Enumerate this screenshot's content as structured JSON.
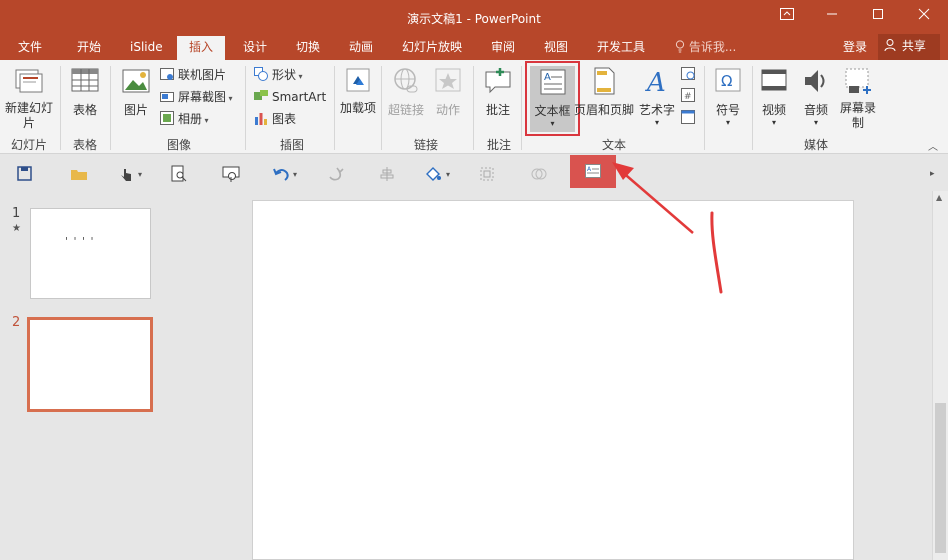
{
  "title": "演示文稿1 - PowerPoint",
  "tabs": [
    "文件",
    "开始",
    "iSlide",
    "插入",
    "设计",
    "切换",
    "动画",
    "幻灯片放映",
    "审阅",
    "视图",
    "开发工具"
  ],
  "tell_me": "告诉我...",
  "signin": "登录",
  "share": "共享",
  "ribbon": {
    "new_slide": "新建幻灯片",
    "slides_group": "幻灯片",
    "table": "表格",
    "tables_group": "表格",
    "picture": "图片",
    "online_picture": "联机图片",
    "screenshot": "屏幕截图",
    "album": "相册",
    "images_group": "图像",
    "shapes": "形状",
    "smartart": "SmartArt",
    "chart": "图表",
    "illustrations_group": "插图",
    "addins": "加载项",
    "hyperlink": "超链接",
    "action": "动作",
    "links_group": "链接",
    "comment": "批注",
    "comments_group": "批注",
    "textbox": "文本框",
    "header_footer": "页眉和页脚",
    "wordart": "艺术字",
    "text_group": "文本",
    "symbols": "符号",
    "video": "视频",
    "audio": "音频",
    "screen_recording": "屏幕录制",
    "media_group": "媒体"
  },
  "slides": [
    {
      "number": "1",
      "star": "★",
      "content": "' ' ' '"
    },
    {
      "number": "2"
    }
  ],
  "colors": {
    "accent": "#b7472a",
    "highlight_box": "#d9363e",
    "arrow": "#e23a3a",
    "active_qat": "#d9534f"
  }
}
